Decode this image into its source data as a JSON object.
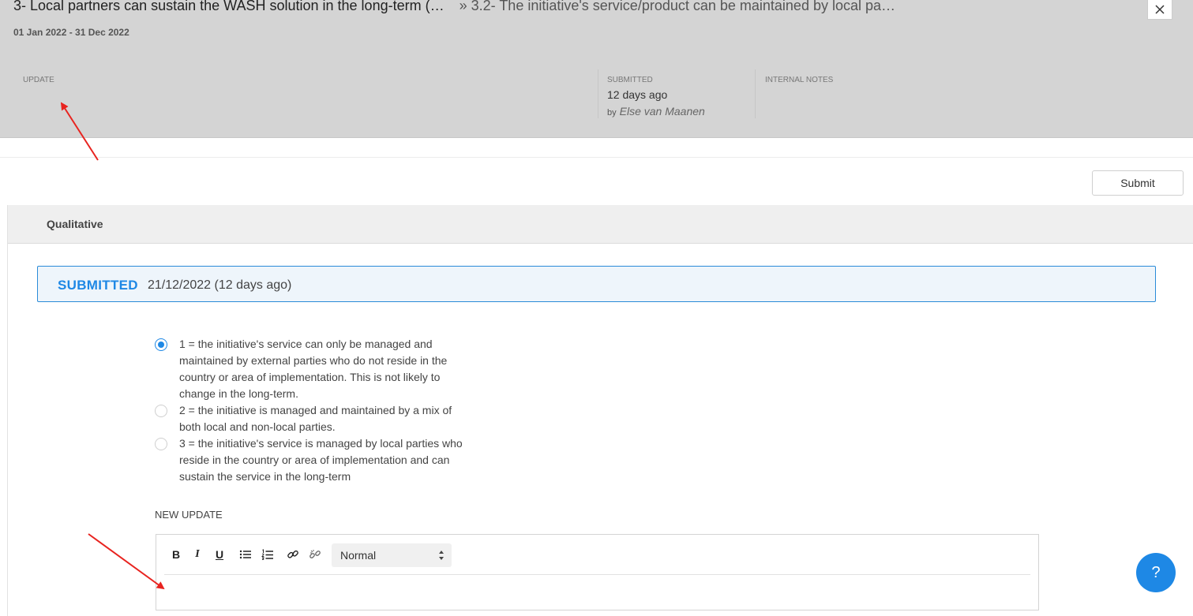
{
  "header": {
    "title": "3- Local partners can sustain the WASH solution in the long-term (…",
    "subtitle": "» 3.2- The initiative's service/product can be maintained by local pa…",
    "period": "01 Jan 2022 - 31 Dec 2022",
    "close_icon": "close-icon",
    "columns": {
      "update_label": "UPDATE",
      "submitted_label": "SUBMITTED",
      "submitted_when": "12 days ago",
      "submitted_by_prefix": "by",
      "submitted_by_name": "Else van Maanen",
      "internal_notes_label": "INTERNAL NOTES"
    }
  },
  "actions": {
    "submit_label": "Submit"
  },
  "section": {
    "title": "Qualitative"
  },
  "status": {
    "label": "SUBMITTED",
    "date": "21/12/2022 (12 days ago)",
    "color": "#1e88e5"
  },
  "options": [
    {
      "text": "1 = the initiative's service can only be managed and maintained by external parties who do not reside in the country or area of implementation. This is not likely to change in the long-term.",
      "selected": true
    },
    {
      "text": "2 = the initiative is managed and maintained by a mix of both local and non-local parties.",
      "selected": false
    },
    {
      "text": "3 = the initiative's service is managed by local parties who reside in the country or area of implementation and can sustain the service in the long-term",
      "selected": false
    }
  ],
  "new_update": {
    "label": "NEW UPDATE",
    "toolbar": {
      "bold": "B",
      "italic": "I",
      "underline": "U",
      "icons": [
        "bullet-list-icon",
        "numbered-list-icon",
        "link-icon",
        "unlink-icon"
      ],
      "style_select_value": "Normal"
    },
    "value": ""
  },
  "help": {
    "label": "?",
    "color": "#1e88e5"
  },
  "annotations": {
    "arrow_color": "#e8231f"
  }
}
